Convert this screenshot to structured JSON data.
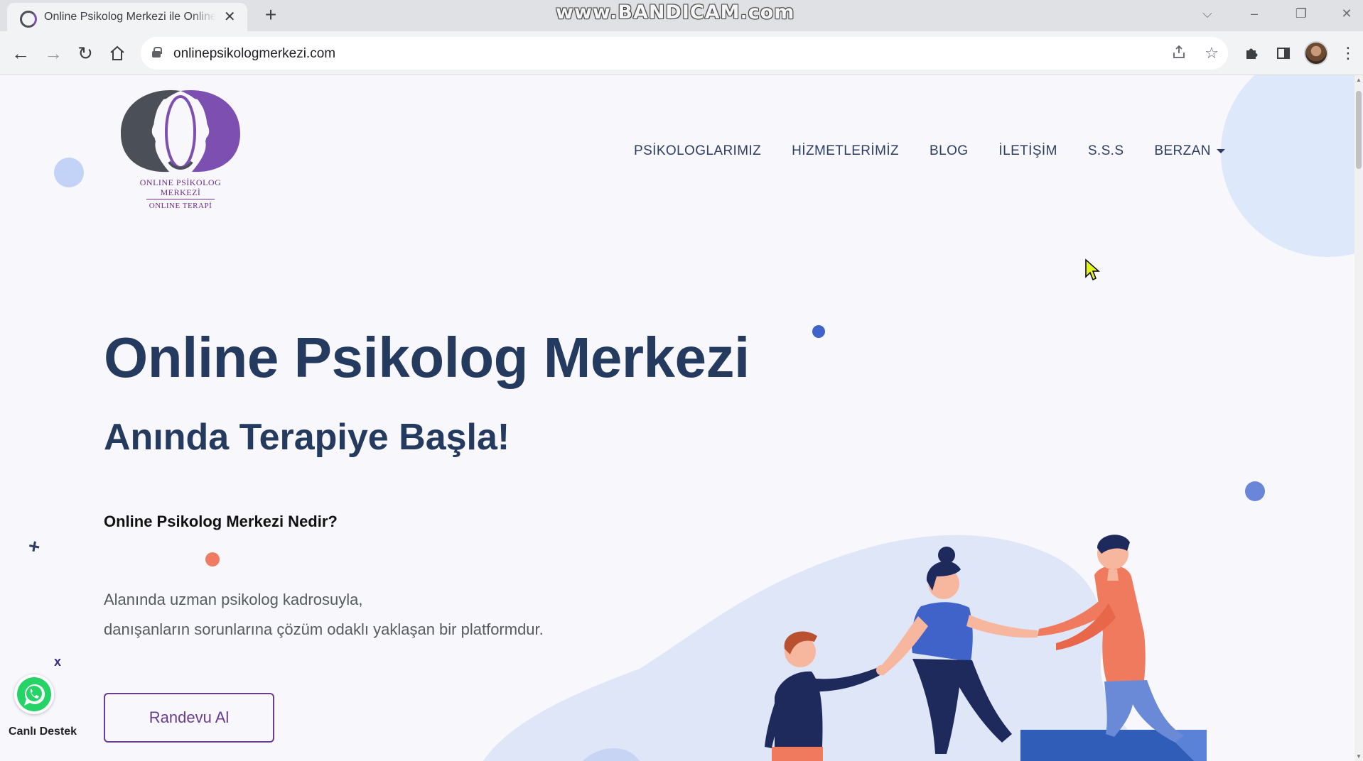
{
  "browser": {
    "tab_title": "Online Psikolog Merkezi ile Online Terapi",
    "tab_close": "✕",
    "new_tab": "+",
    "url": "onlinepsikologmerkezi.com",
    "watermark": "www.BANDICAM.com"
  },
  "site": {
    "logo": {
      "line1": "ONLINE PSİKOLOG",
      "line2": "MERKEZİ",
      "line3": "ONLINE TERAPİ"
    },
    "nav": {
      "items": [
        "PSİKOLOGLARIMIZ",
        "HİZMETLERİMİZ",
        "BLOG",
        "İLETİŞİM",
        "S.S.S"
      ],
      "user": "BERZAN"
    },
    "hero": {
      "title": "Online Psikolog Merkezi",
      "subtitle": "Anında Terapiye Başla!",
      "question": "Online Psikolog Merkezi Nedir?",
      "desc_line1": "Alanında uzman psikolog kadrosuyla,",
      "desc_line2": "danışanların sorunlarına çözüm odaklı yaklaşan bir platformdur.",
      "cta": "Randevu Al"
    },
    "whatsapp": {
      "close": "x",
      "label": "Canlı Destek"
    }
  },
  "colors": {
    "heading": "#243a5e",
    "brand_purple": "#6a3c8f",
    "accent_blue": "#3f63c8",
    "accent_coral": "#ee7b62",
    "page_bg": "#f8f7fb"
  }
}
